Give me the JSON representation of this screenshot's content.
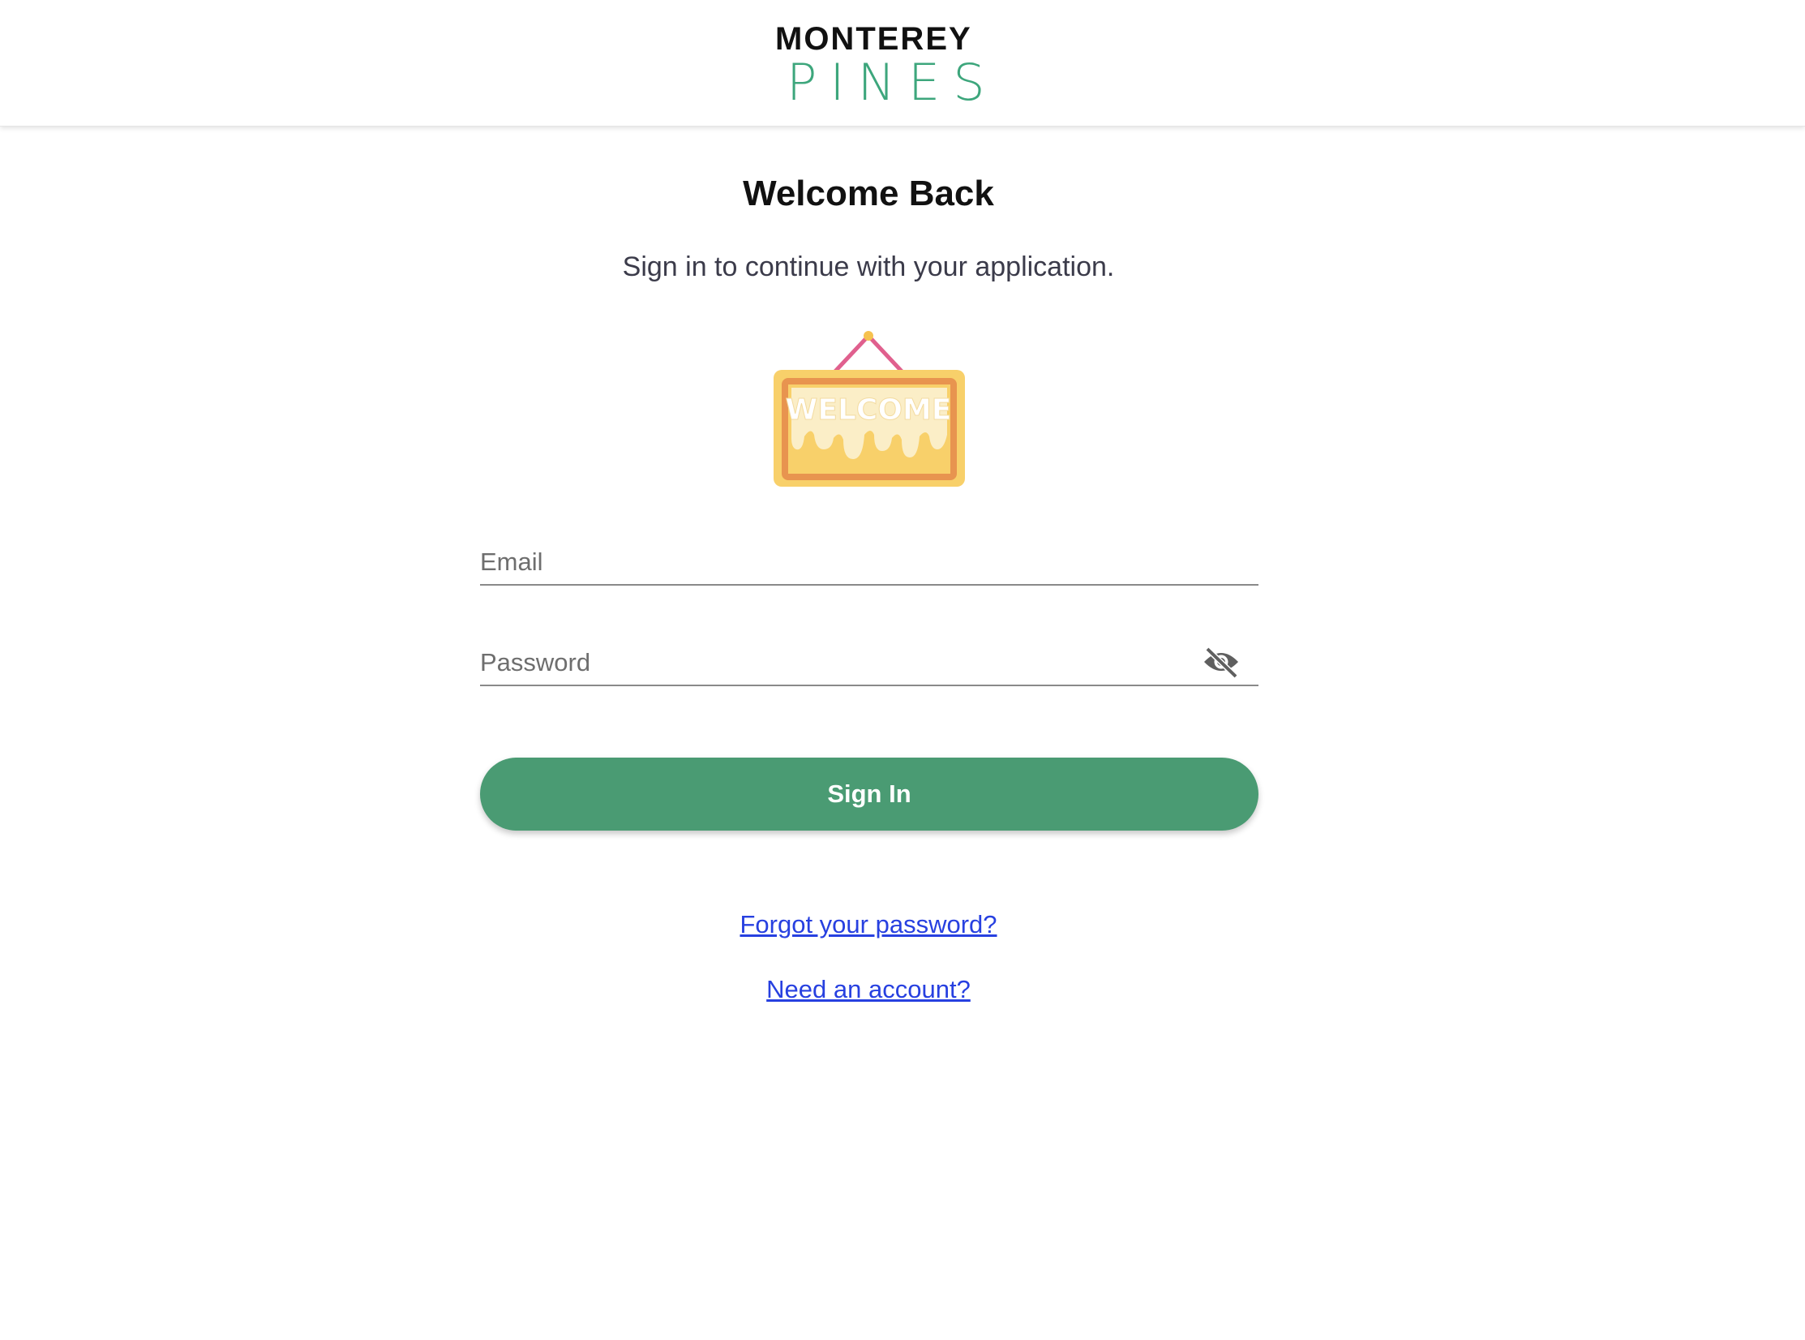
{
  "brand": {
    "line1": "MONTEREY",
    "line2": "PINES",
    "accent_color": "#3da67c"
  },
  "page": {
    "title": "Welcome Back",
    "subtitle": "Sign in to continue with your application.",
    "illustration": {
      "icon": "welcome-sign-icon",
      "text": "WELCOME"
    }
  },
  "form": {
    "email": {
      "value": "",
      "placeholder": "Email"
    },
    "password": {
      "value": "",
      "placeholder": "Password",
      "toggle_icon": "eye-slash-icon"
    },
    "submit_label": "Sign In",
    "button_color": "#4a9b73"
  },
  "links": {
    "forgot_password": "Forgot your password?",
    "need_account": "Need an account?",
    "link_color": "#2740e0"
  }
}
